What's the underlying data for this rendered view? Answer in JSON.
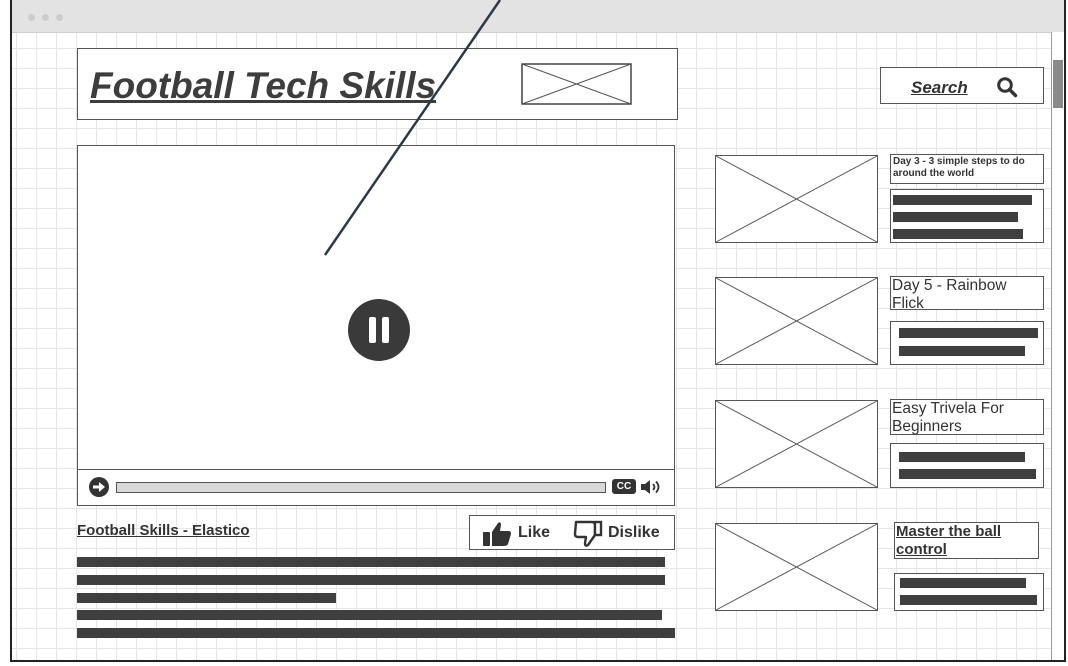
{
  "header": {
    "site_title": "Football Tech Skills",
    "logo_icon": "image-placeholder-icon"
  },
  "search": {
    "label": "Search",
    "icon": "search-icon"
  },
  "video": {
    "state_icon": "pause-icon",
    "progress": 0,
    "controls": {
      "play_icon": "arrow-right-circle-icon",
      "cc_label": "CC",
      "volume_icon": "speaker-icon"
    },
    "title": "Football Skills - Elastico",
    "like_label": "Like",
    "dislike_label": "Dislike"
  },
  "sidebar": {
    "items": [
      {
        "title": "Day 3 - 3 simple steps to do around the world"
      },
      {
        "title": "Day 5 - Rainbow Flick"
      },
      {
        "title": "Easy Trivela For Beginners"
      },
      {
        "title": "Master the ball control"
      }
    ]
  },
  "colors": {
    "ink": "#333333",
    "text_bar": "#3f3f3f",
    "grid": "#e6e6e6",
    "titlebar": "#e3e3e3"
  }
}
